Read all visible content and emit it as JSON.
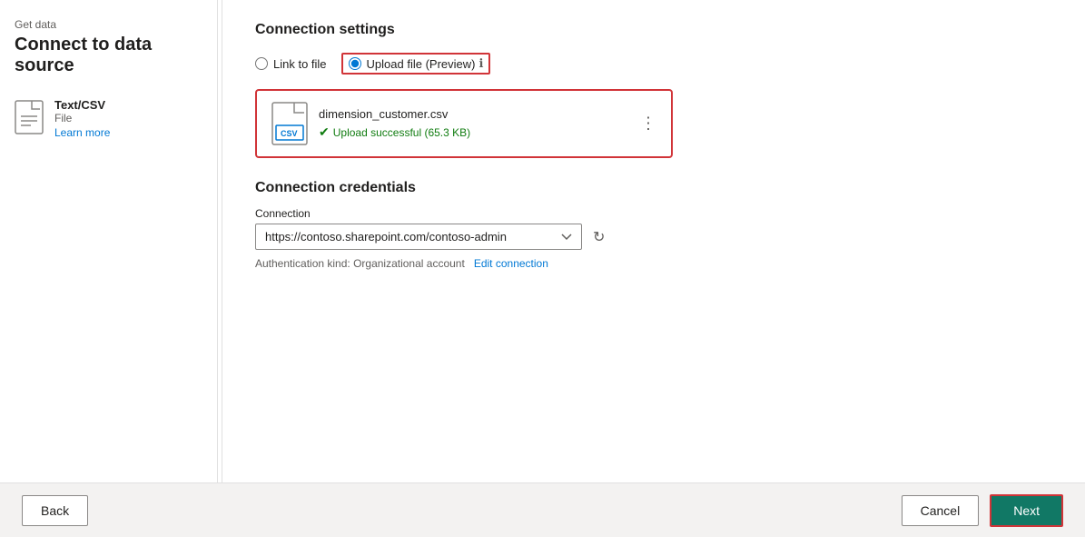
{
  "header": {
    "page_label": "Get data",
    "page_title": "Connect to data source"
  },
  "sidebar": {
    "file_type_name": "Text/CSV",
    "file_type_label": "File",
    "learn_more": "Learn more"
  },
  "connection_settings": {
    "section_title": "Connection settings",
    "link_to_file_label": "Link to file",
    "upload_file_label": "Upload file (Preview)",
    "file_name": "dimension_customer.csv",
    "upload_status": "Upload successful (65.3 KB)",
    "more_options_icon": "⋮"
  },
  "connection_credentials": {
    "section_title": "Connection credentials",
    "connection_label": "Connection",
    "connection_value": "https://contoso.sharepoint.com/contoso-admin",
    "auth_text": "Authentication kind: Organizational account",
    "edit_connection_label": "Edit connection"
  },
  "footer": {
    "back_label": "Back",
    "cancel_label": "Cancel",
    "next_label": "Next"
  }
}
